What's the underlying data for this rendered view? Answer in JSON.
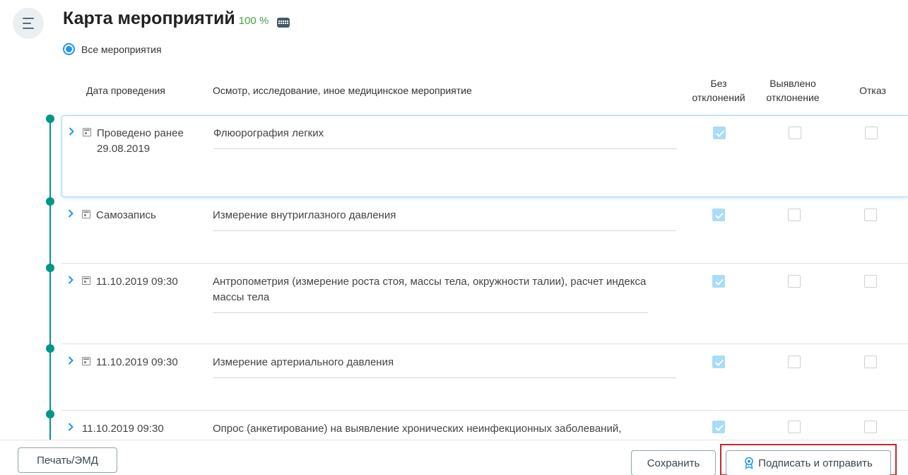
{
  "header": {
    "title": "Карта мероприятий",
    "percent": "100 %",
    "filter_label": "Все мероприятия"
  },
  "columns": {
    "date": "Дата проведения",
    "event": "Осмотр, исследование, иное медицинское мероприятие",
    "no_deviation": "Без отклонений",
    "deviation": "Выявлено отклонение",
    "refusal": "Отказ"
  },
  "rows": [
    {
      "date_line1": "Проведено ранее",
      "date_line2": "29.08.2019",
      "event": "Флюорография легких",
      "no_deviation": true,
      "deviation": false,
      "refusal": false,
      "calendar_icon": true
    },
    {
      "date_line1": "Самозапись",
      "date_line2": "",
      "event": "Измерение внутриглазного давления",
      "no_deviation": true,
      "deviation": false,
      "refusal": false,
      "calendar_icon": true
    },
    {
      "date_line1": "11.10.2019 09:30",
      "date_line2": "",
      "event": "Антропометрия (измерение роста стоя, массы тела, окружности талии), расчет индекса массы тела",
      "no_deviation": true,
      "deviation": false,
      "refusal": false,
      "calendar_icon": true
    },
    {
      "date_line1": "11.10.2019 09:30",
      "date_line2": "",
      "event": "Измерение артериального давления",
      "no_deviation": true,
      "deviation": false,
      "refusal": false,
      "calendar_icon": true
    },
    {
      "date_line1": "11.10.2019 09:30",
      "date_line2": "",
      "event": "Опрос (анкетирование) на выявление хронических неинфекционных заболеваний,",
      "no_deviation": true,
      "deviation": false,
      "refusal": false,
      "calendar_icon": false
    }
  ],
  "footer": {
    "print_label": "Печать/ЭМД",
    "save_label": "Сохранить",
    "sign_label": "Подписать и отправить"
  },
  "colors": {
    "accent_blue": "#2196f3",
    "timeline_teal": "#009688",
    "percent_green": "#43a047",
    "highlight_red": "#c62828"
  }
}
